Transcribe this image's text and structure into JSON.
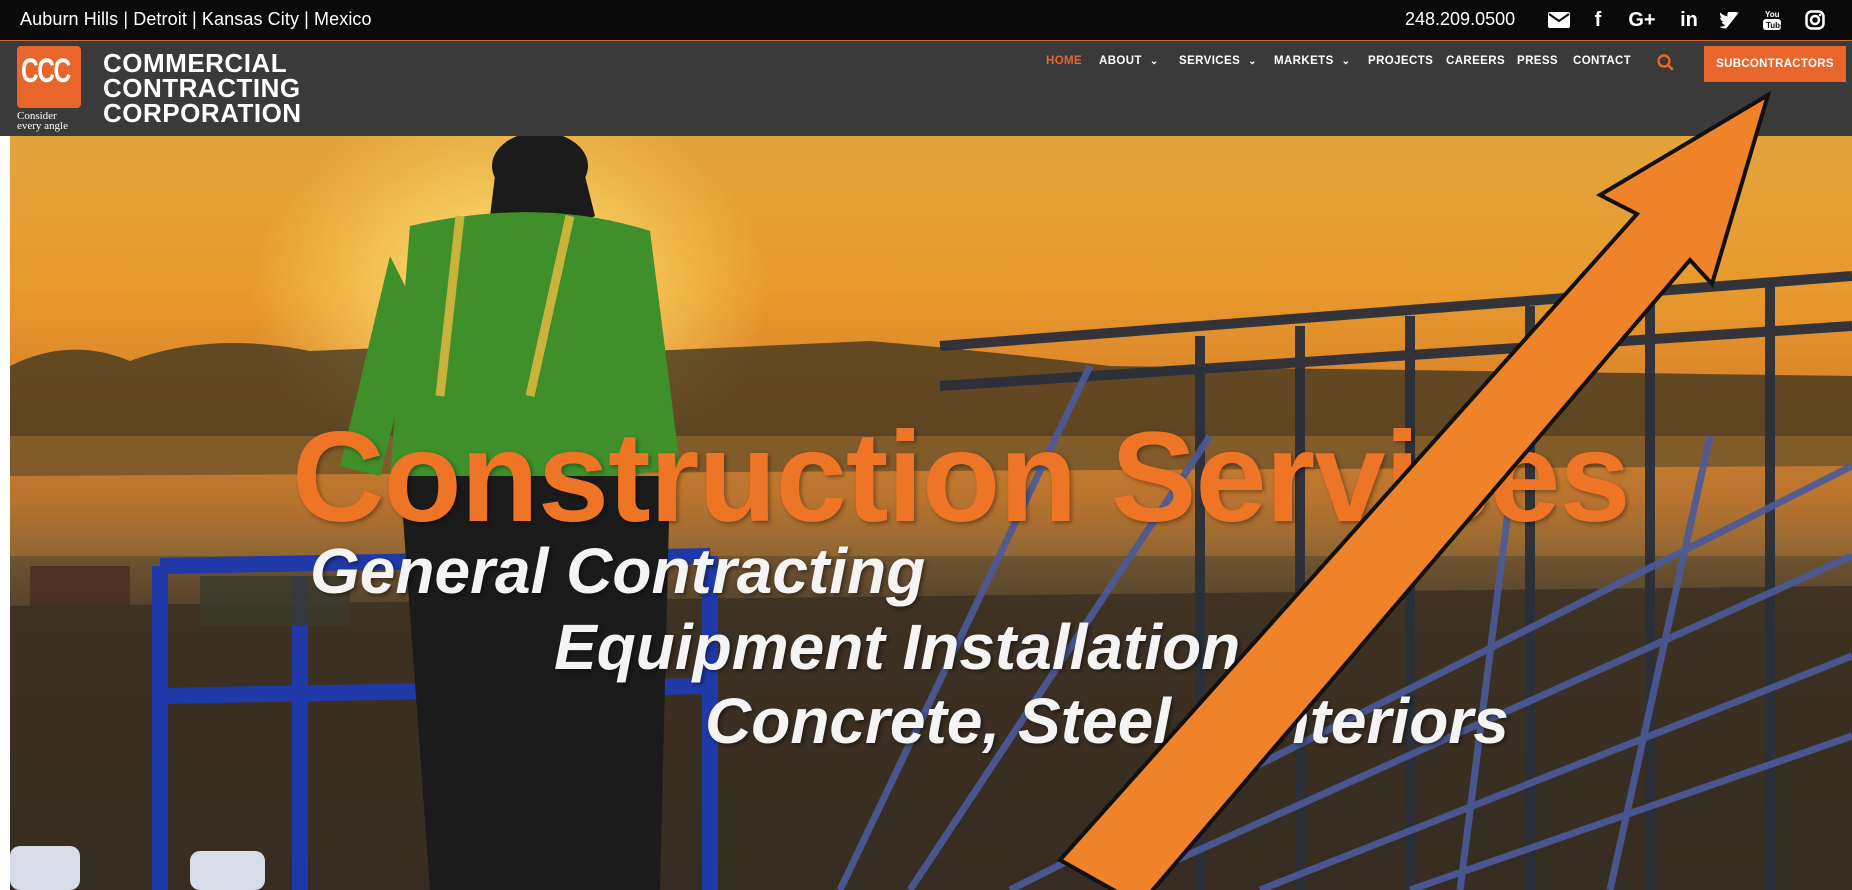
{
  "topbar": {
    "locations": "Auburn Hills | Detroit | Kansas City | Mexico",
    "phone": "248.209.0500",
    "social": [
      {
        "name": "email-icon",
        "glyph": "✉"
      },
      {
        "name": "facebook-icon",
        "glyph": "f"
      },
      {
        "name": "google-plus-icon",
        "glyph": "G+"
      },
      {
        "name": "linkedin-icon",
        "glyph": "in"
      },
      {
        "name": "twitter-icon",
        "glyph": "🐦"
      },
      {
        "name": "youtube-icon",
        "glyph": "You"
      },
      {
        "name": "instagram-icon",
        "glyph": "◎"
      }
    ]
  },
  "logo": {
    "mark": "CCC",
    "tagline_1": "Consider",
    "tagline_2": "every angle",
    "line1": "COMMERCIAL",
    "line2": "CONTRACTING",
    "line3": "CORPORATION"
  },
  "nav": {
    "items": [
      {
        "label": "HOME",
        "active": true
      },
      {
        "label": "ABOUT",
        "dropdown": true
      },
      {
        "label": "SERVICES",
        "dropdown": true
      },
      {
        "label": "MARKETS",
        "dropdown": true
      },
      {
        "label": "PROJECTS"
      },
      {
        "label": "CAREERS"
      },
      {
        "label": "PRESS"
      },
      {
        "label": "CONTACT"
      }
    ],
    "search_icon": "search-icon",
    "cta_label": "SUBCONTRACTORS"
  },
  "hero": {
    "title": "Construction Services",
    "line1": "General Contracting",
    "line2": "Equipment Installation",
    "line3": "Concrete, Steel & Interiors"
  },
  "colors": {
    "accent": "#e8652b",
    "topbar_bg": "#0a0a0a",
    "header_bg": "#3a3a3a",
    "annotation_arrow": "#f0822a"
  }
}
